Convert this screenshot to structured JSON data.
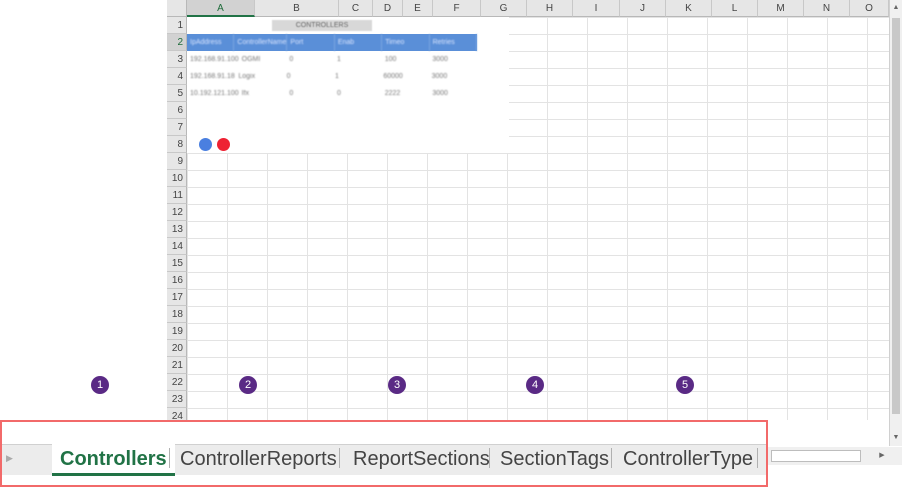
{
  "spreadsheet": {
    "columns": [
      "A",
      "B",
      "C",
      "D",
      "E",
      "F",
      "G",
      "H",
      "I",
      "J",
      "K",
      "L",
      "M",
      "N",
      "O"
    ],
    "selected_column": "A",
    "rows": [
      "1",
      "2",
      "3",
      "4",
      "5",
      "6",
      "7",
      "8",
      "9",
      "10",
      "11",
      "12",
      "13",
      "14",
      "15",
      "16",
      "17",
      "18",
      "19",
      "20",
      "21",
      "22",
      "23",
      "24"
    ],
    "selected_row": "2"
  },
  "embedded_table": {
    "title": "CONTROLLERS",
    "headers": [
      "IpAddress",
      "ControllerName",
      "Port",
      "Enab",
      "Timeo",
      "Retries"
    ],
    "rows": [
      [
        "192.168.91.100",
        "OGMI",
        "0",
        "1",
        "100",
        "3000"
      ],
      [
        "192.168.91.18",
        "Logix",
        "0",
        "1",
        "60000",
        "3000"
      ],
      [
        "10.192.121.100",
        "Ifx",
        "0",
        "0",
        "2222",
        "3000"
      ]
    ]
  },
  "sheet_tabs": {
    "tabs": [
      "Controllers",
      "ControllerReports",
      "ReportSections",
      "SectionTags",
      "ControllerType"
    ],
    "active": "Controllers"
  },
  "callouts": [
    "1",
    "2",
    "3",
    "4",
    "5"
  ],
  "colors": {
    "accent_green": "#217346",
    "highlight_border": "#f26a6a",
    "callout_purple": "#5a2a85"
  },
  "icons": {
    "scroll_up": "▲",
    "scroll_down": "▼",
    "scroll_left": "◀",
    "scroll_right": "▶",
    "tab_nav": "▶"
  }
}
